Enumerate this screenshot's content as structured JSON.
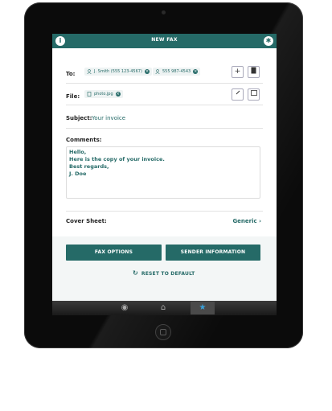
{
  "header": {
    "title": "NEW FAX"
  },
  "to": {
    "label": "To:",
    "recipients": [
      {
        "name": "J. Smith (555 123-4567)"
      },
      {
        "name": "555 987-4543"
      }
    ]
  },
  "file": {
    "label": "File:",
    "attachments": [
      {
        "name": "photo.jpg"
      }
    ]
  },
  "subject": {
    "label": "Subject:",
    "value": "Your invoice"
  },
  "comments": {
    "label": "Comments:",
    "lines": [
      "Hello,",
      "Here is the copy of your invoice.",
      "Best regards,",
      "J. Doe"
    ]
  },
  "cover_sheet": {
    "label": "Cover Sheet:",
    "value": "Generic"
  },
  "buttons": {
    "fax_options": "FAX OPTIONS",
    "sender_information": "SENDER INFORMATION",
    "reset": "RESET TO DEFAULT"
  },
  "tabs": [
    {
      "icon": "camera-icon"
    },
    {
      "icon": "home-icon"
    },
    {
      "icon": "star-icon",
      "active": true
    }
  ],
  "colors": {
    "accent": "#256a67"
  }
}
